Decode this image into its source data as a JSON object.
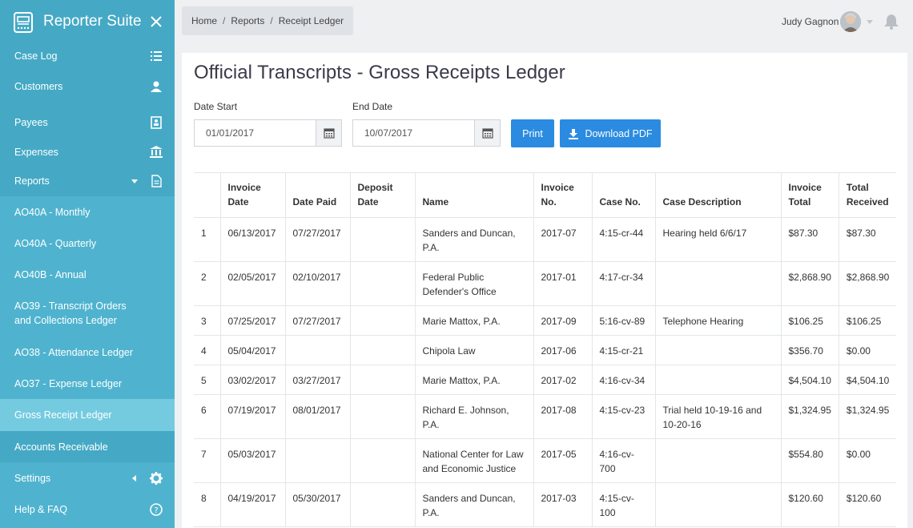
{
  "app": {
    "title": "Reporter Suite"
  },
  "sidebar": {
    "items": [
      {
        "label": "Case Log",
        "icon": "list-icon"
      },
      {
        "label": "Customers",
        "icon": "user-icon"
      },
      {
        "label": "Payees",
        "icon": "contact-book-icon"
      },
      {
        "label": "Expenses",
        "icon": "bank-icon"
      },
      {
        "label": "Reports",
        "icon": "document-icon"
      },
      {
        "label": "AO40A - Monthly"
      },
      {
        "label": "AO40A - Quarterly"
      },
      {
        "label": "AO40B - Annual"
      },
      {
        "label": "AO39 - Transcript Orders and Collections Ledger"
      },
      {
        "label": "AO38 - Attendance Ledger"
      },
      {
        "label": "AO37 - Expense Ledger"
      },
      {
        "label": "Gross Receipt Ledger"
      },
      {
        "label": "Accounts Receivable"
      },
      {
        "label": "Settings",
        "icon": "gear-icon"
      },
      {
        "label": "Help & FAQ",
        "icon": "help-circle-icon"
      }
    ]
  },
  "breadcrumb": {
    "home": "Home",
    "reports": "Reports",
    "current": "Receipt Ledger"
  },
  "user": {
    "name": "Judy Gagnon"
  },
  "page": {
    "title": "Official Transcripts - Gross Receipts Ledger",
    "date_start_label": "Date Start",
    "date_start_value": "01/01/2017",
    "end_date_label": "End Date",
    "end_date_value": "10/07/2017",
    "print_label": "Print",
    "download_label": "Download PDF"
  },
  "table": {
    "headers": {
      "invoice_date": [
        "Invoice",
        "Date"
      ],
      "date_paid": "Date Paid",
      "deposit_date": [
        "Deposit",
        "Date"
      ],
      "name": "Name",
      "invoice_no": [
        "Invoice",
        "No."
      ],
      "case_no": "Case No.",
      "case_description": "Case Description",
      "invoice_total": [
        "Invoice",
        "Total"
      ],
      "total_received": [
        "Total",
        "Received"
      ]
    },
    "rows": [
      {
        "n": "1",
        "invoice_date": "06/13/2017",
        "date_paid": "07/27/2017",
        "deposit_date": "",
        "name": "Sanders and Duncan, P.A.",
        "invoice_no": "2017-07",
        "case_no": "4:15-cr-44",
        "desc": "Hearing held 6/6/17",
        "invoice_total": "$87.30",
        "received": "$87.30"
      },
      {
        "n": "2",
        "invoice_date": "02/05/2017",
        "date_paid": "02/10/2017",
        "deposit_date": "",
        "name": "Federal Public Defender's Office",
        "invoice_no": "2017-01",
        "case_no": "4:17-cr-34",
        "desc": "",
        "invoice_total": "$2,868.90",
        "received": "$2,868.90"
      },
      {
        "n": "3",
        "invoice_date": "07/25/2017",
        "date_paid": "07/27/2017",
        "deposit_date": "",
        "name": "Marie Mattox, P.A.",
        "invoice_no": "2017-09",
        "case_no": "5:16-cv-89",
        "desc": "Telephone Hearing",
        "invoice_total": "$106.25",
        "received": "$106.25"
      },
      {
        "n": "4",
        "invoice_date": "05/04/2017",
        "date_paid": "",
        "deposit_date": "",
        "name": "Chipola Law",
        "invoice_no": "2017-06",
        "case_no": "4:15-cr-21",
        "desc": "",
        "invoice_total": "$356.70",
        "received": "$0.00"
      },
      {
        "n": "5",
        "invoice_date": "03/02/2017",
        "date_paid": "03/27/2017",
        "deposit_date": "",
        "name": "Marie Mattox, P.A.",
        "invoice_no": "2017-02",
        "case_no": "4:16-cv-34",
        "desc": "",
        "invoice_total": "$4,504.10",
        "received": "$4,504.10"
      },
      {
        "n": "6",
        "invoice_date": "07/19/2017",
        "date_paid": "08/01/2017",
        "deposit_date": "",
        "name": "Richard E. Johnson, P.A.",
        "invoice_no": "2017-08",
        "case_no": "4:15-cv-23",
        "desc": "Trial held 10-19-16 and 10-20-16",
        "invoice_total": "$1,324.95",
        "received": "$1,324.95"
      },
      {
        "n": "7",
        "invoice_date": "05/03/2017",
        "date_paid": "",
        "deposit_date": "",
        "name": "National Center for Law and Economic Justice",
        "invoice_no": "2017-05",
        "case_no": "4:16-cv-700",
        "desc": "",
        "invoice_total": "$554.80",
        "received": "$0.00"
      },
      {
        "n": "8",
        "invoice_date": "04/19/2017",
        "date_paid": "05/30/2017",
        "deposit_date": "",
        "name": "Sanders and Duncan, P.A.",
        "invoice_no": "2017-03",
        "case_no": "4:15-cv-100",
        "desc": "",
        "invoice_total": "$120.60",
        "received": "$120.60"
      }
    ]
  }
}
